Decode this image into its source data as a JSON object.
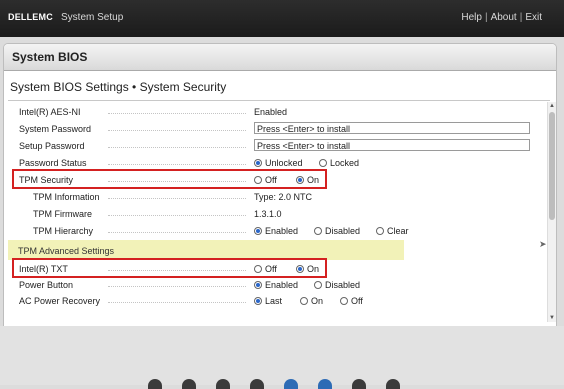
{
  "top_bar": {
    "logo": "DELLEMC",
    "app_title": "System Setup",
    "help": "Help",
    "about": "About",
    "exit": "Exit",
    "separator": "|"
  },
  "panel": {
    "title": "System BIOS",
    "subtitle": "System BIOS Settings • System Security"
  },
  "settings": {
    "aes": {
      "label": "Intel(R) AES-NI",
      "value": "Enabled"
    },
    "system_password": {
      "label": "System Password",
      "value": "Press <Enter> to install"
    },
    "setup_password": {
      "label": "Setup Password",
      "value": "Press <Enter> to install"
    },
    "password_status": {
      "label": "Password Status",
      "options": [
        "Unlocked",
        "Locked"
      ],
      "selected": "Unlocked"
    },
    "tpm_security": {
      "label": "TPM Security",
      "options": [
        "Off",
        "On"
      ],
      "selected": "On"
    },
    "tpm_information": {
      "label": "TPM Information",
      "value": "Type: 2.0  NTC"
    },
    "tpm_firmware": {
      "label": "TPM Firmware",
      "value": "1.3.1.0"
    },
    "tpm_hierarchy": {
      "label": "TPM Hierarchy",
      "options": [
        "Enabled",
        "Disabled",
        "Clear"
      ],
      "selected": "Enabled"
    },
    "section_tpm_advanced": "TPM Advanced Settings",
    "intel_txt": {
      "label": "Intel(R) TXT",
      "options": [
        "Off",
        "On"
      ],
      "selected": "On"
    },
    "power_button": {
      "label": "Power Button",
      "options": [
        "Enabled",
        "Disabled"
      ],
      "selected": "Enabled"
    },
    "ac_power_recovery": {
      "label": "AC Power Recovery",
      "options": [
        "Last",
        "On",
        "Off"
      ],
      "selected": "Last"
    }
  },
  "colors": {
    "highlight_box": "#d42121",
    "section_bg": "#f2f2b8",
    "radio_selected": "#2a66c9",
    "top_bar": "#1f1f1f"
  }
}
